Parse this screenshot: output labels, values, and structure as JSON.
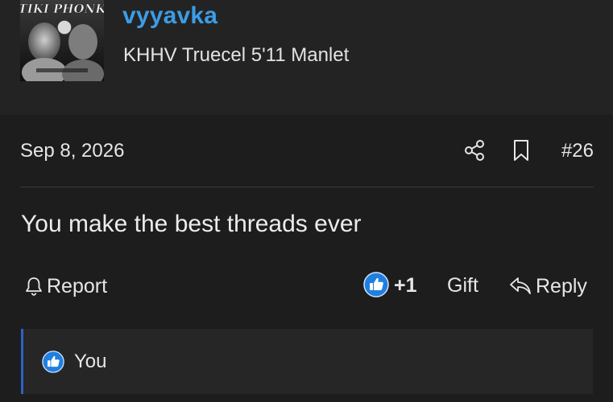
{
  "user": {
    "avatar_text": "TIKI PHONK",
    "username": "vyyavka",
    "title": "KHHV Truecel 5'11 Manlet"
  },
  "post": {
    "date": "Sep 8, 2026",
    "number": "#26",
    "body": "You make the best threads ever"
  },
  "actions": {
    "report_label": "Report",
    "like_count": "+1",
    "gift_label": "Gift",
    "reply_label": "Reply"
  },
  "reactions": {
    "text": "You"
  },
  "colors": {
    "accent": "#3b9ce6",
    "like_badge": "#1f7fe0",
    "reactions_border": "#2f62c4"
  },
  "icons": [
    "share-icon",
    "bookmark-icon",
    "bell-icon",
    "thumbs-up-icon",
    "reply-arrow-icon"
  ]
}
